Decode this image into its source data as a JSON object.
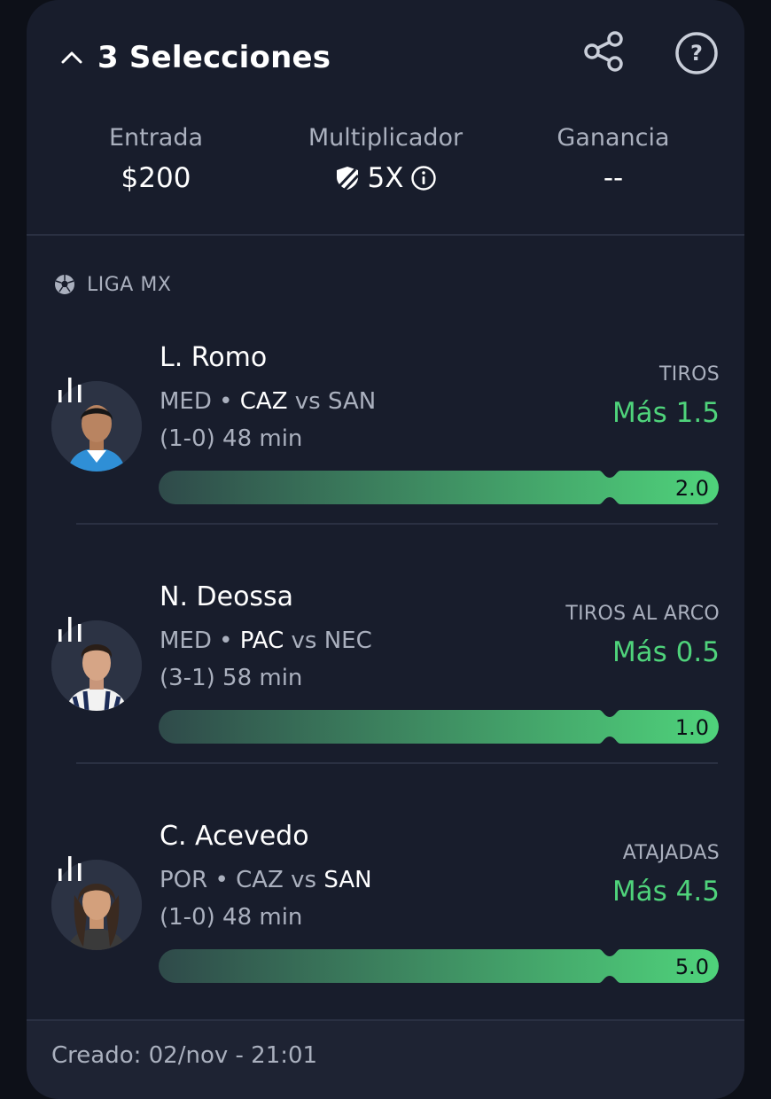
{
  "header": {
    "title": "3 Selecciones"
  },
  "stats": {
    "entry_label": "Entrada",
    "entry_value": "$200",
    "multiplier_label": "Multiplicador",
    "multiplier_value": "5X",
    "payout_label": "Ganancia",
    "payout_value": "--"
  },
  "league": {
    "name": "LIGA MX"
  },
  "picks": [
    {
      "player": "L. Romo",
      "position": "MED",
      "team": "CAZ",
      "vs": "vs",
      "opponent": "SAN",
      "bold_side": "team",
      "score": "(1-0)",
      "time": "48 min",
      "stat_type": "TIROS",
      "line": "Más 1.5",
      "line_value": 1.5,
      "current": "2.0",
      "progress": 1.0
    },
    {
      "player": "N. Deossa",
      "position": "MED",
      "team": "PAC",
      "vs": "vs",
      "opponent": "NEC",
      "bold_side": "team",
      "score": "(3-1)",
      "time": "58 min",
      "stat_type": "TIROS AL ARCO",
      "line": "Más 0.5",
      "line_value": 0.5,
      "current": "1.0",
      "progress": 1.0
    },
    {
      "player": "C. Acevedo",
      "position": "POR",
      "team": "CAZ",
      "vs": "vs",
      "opponent": "SAN",
      "bold_side": "opponent",
      "score": "(1-0)",
      "time": "48 min",
      "stat_type": "ATAJADAS",
      "line": "Más 4.5",
      "line_value": 4.5,
      "current": "5.0",
      "progress": 1.0
    }
  ],
  "footer": {
    "created": "Creado: 02/nov - 21:01"
  },
  "colors": {
    "background": "#0d1018",
    "card": "#181d2c",
    "accent_green": "#4fd37b",
    "muted_text": "#aab0be"
  }
}
